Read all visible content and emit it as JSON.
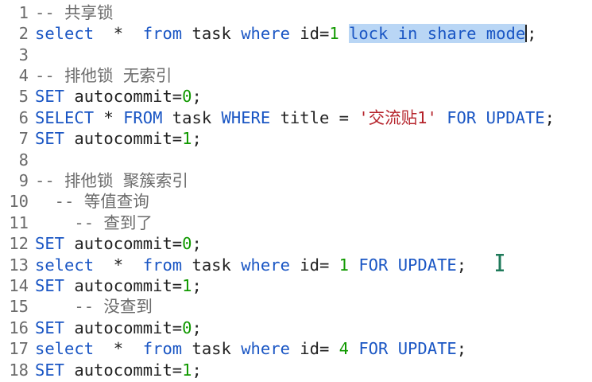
{
  "editor": {
    "lines": [
      {
        "num": "1",
        "tokens": [
          {
            "t": "-- 共享锁",
            "c": "cmt"
          }
        ]
      },
      {
        "num": "2",
        "tokens": [
          {
            "t": "select",
            "c": "kw"
          },
          {
            "t": "  *  ",
            "c": "plain"
          },
          {
            "t": "from",
            "c": "kw"
          },
          {
            "t": " task ",
            "c": "plain"
          },
          {
            "t": "where",
            "c": "kw"
          },
          {
            "t": " id=",
            "c": "plain"
          },
          {
            "t": "1",
            "c": "num"
          },
          {
            "t": " ",
            "c": "plain"
          },
          {
            "t": "lock in share mode",
            "c": "kw sel"
          },
          {
            "t": ";",
            "c": "plain"
          }
        ]
      },
      {
        "num": "3",
        "tokens": []
      },
      {
        "num": "4",
        "tokens": [
          {
            "t": "-- 排他锁 无索引",
            "c": "cmt"
          }
        ]
      },
      {
        "num": "5",
        "tokens": [
          {
            "t": "SET",
            "c": "kw"
          },
          {
            "t": " autocommit=",
            "c": "plain"
          },
          {
            "t": "0",
            "c": "num"
          },
          {
            "t": ";",
            "c": "plain"
          }
        ]
      },
      {
        "num": "6",
        "tokens": [
          {
            "t": "SELECT",
            "c": "kw"
          },
          {
            "t": " * ",
            "c": "plain"
          },
          {
            "t": "FROM",
            "c": "kw"
          },
          {
            "t": " task ",
            "c": "plain"
          },
          {
            "t": "WHERE",
            "c": "kw"
          },
          {
            "t": " title = ",
            "c": "plain"
          },
          {
            "t": "'交流贴1'",
            "c": "str"
          },
          {
            "t": " ",
            "c": "plain"
          },
          {
            "t": "FOR UPDATE",
            "c": "kw"
          },
          {
            "t": ";",
            "c": "plain"
          }
        ]
      },
      {
        "num": "7",
        "tokens": [
          {
            "t": "SET",
            "c": "kw"
          },
          {
            "t": " autocommit=",
            "c": "plain"
          },
          {
            "t": "1",
            "c": "num"
          },
          {
            "t": ";",
            "c": "plain"
          }
        ]
      },
      {
        "num": "8",
        "tokens": []
      },
      {
        "num": "9",
        "tokens": [
          {
            "t": "-- 排他锁 聚簇索引",
            "c": "cmt"
          }
        ]
      },
      {
        "num": "10",
        "tokens": [
          {
            "t": "  -- 等值查询",
            "c": "cmt"
          }
        ]
      },
      {
        "num": "11",
        "tokens": [
          {
            "t": "    -- 查到了",
            "c": "cmt"
          }
        ]
      },
      {
        "num": "12",
        "tokens": [
          {
            "t": "SET",
            "c": "kw"
          },
          {
            "t": " autocommit=",
            "c": "plain"
          },
          {
            "t": "0",
            "c": "num"
          },
          {
            "t": ";",
            "c": "plain"
          }
        ]
      },
      {
        "num": "13",
        "tokens": [
          {
            "t": "select",
            "c": "kw"
          },
          {
            "t": "  *  ",
            "c": "plain"
          },
          {
            "t": "from",
            "c": "kw"
          },
          {
            "t": " task ",
            "c": "plain"
          },
          {
            "t": "where",
            "c": "kw"
          },
          {
            "t": " id= ",
            "c": "plain"
          },
          {
            "t": "1",
            "c": "num"
          },
          {
            "t": " ",
            "c": "plain"
          },
          {
            "t": "FOR UPDATE",
            "c": "kw"
          },
          {
            "t": ";",
            "c": "plain"
          }
        ]
      },
      {
        "num": "14",
        "tokens": [
          {
            "t": "SET",
            "c": "kw"
          },
          {
            "t": " autocommit=",
            "c": "plain"
          },
          {
            "t": "1",
            "c": "num"
          },
          {
            "t": ";",
            "c": "plain"
          }
        ]
      },
      {
        "num": "15",
        "tokens": [
          {
            "t": "    -- 没查到",
            "c": "cmt"
          }
        ]
      },
      {
        "num": "16",
        "tokens": [
          {
            "t": "SET",
            "c": "kw"
          },
          {
            "t": " autocommit=",
            "c": "plain"
          },
          {
            "t": "0",
            "c": "num"
          },
          {
            "t": ";",
            "c": "plain"
          }
        ]
      },
      {
        "num": "17",
        "tokens": [
          {
            "t": "select",
            "c": "kw"
          },
          {
            "t": "  *  ",
            "c": "plain"
          },
          {
            "t": "from",
            "c": "kw"
          },
          {
            "t": " task ",
            "c": "plain"
          },
          {
            "t": "where",
            "c": "kw"
          },
          {
            "t": " id= ",
            "c": "plain"
          },
          {
            "t": "4",
            "c": "num"
          },
          {
            "t": " ",
            "c": "plain"
          },
          {
            "t": "FOR UPDATE",
            "c": "kw"
          },
          {
            "t": ";",
            "c": "plain"
          }
        ]
      },
      {
        "num": "18",
        "tokens": [
          {
            "t": "SET",
            "c": "kw"
          },
          {
            "t": " autocommit=",
            "c": "plain"
          },
          {
            "t": "1",
            "c": "num"
          },
          {
            "t": ";",
            "c": "plain"
          }
        ]
      }
    ],
    "colors": {
      "keyword": "#1a56c4",
      "number": "#119900",
      "string": "#b5222a",
      "comment": "#6b6b6b",
      "selection": "#b9d6f5"
    },
    "cursor_icon": "text-ibeam-cursor-icon"
  }
}
